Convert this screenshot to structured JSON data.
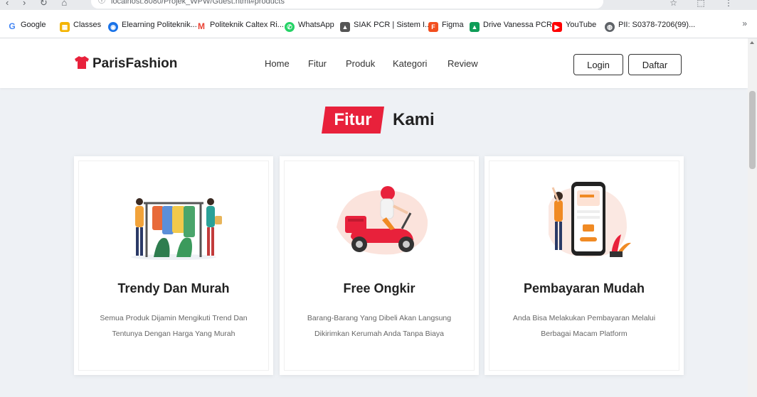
{
  "browser": {
    "address": "localhost:8080/Projek_WPW/Guest.html#products",
    "bookmarks": [
      {
        "label": "Google",
        "icon": "google-icon",
        "color": "#4285f4"
      },
      {
        "label": "Classes",
        "icon": "classes-icon",
        "color": "#f4b400"
      },
      {
        "label": "Elearning Politeknik...",
        "icon": "elearning-icon",
        "color": "#1a73e8"
      },
      {
        "label": "Politeknik Caltex Ri...",
        "icon": "gmail-icon",
        "color": "#ea4335"
      },
      {
        "label": "WhatsApp",
        "icon": "whatsapp-icon",
        "color": "#25d366"
      },
      {
        "label": "SIAK PCR | Sistem I...",
        "icon": "siak-icon",
        "color": "#555555"
      },
      {
        "label": "Figma",
        "icon": "figma-icon",
        "color": "#f24e1e"
      },
      {
        "label": "Drive Vanessa PCR",
        "icon": "drive-icon",
        "color": "#0f9d58"
      },
      {
        "label": "YouTube",
        "icon": "youtube-icon",
        "color": "#ff0000"
      },
      {
        "label": "PII: S0378-7206(99)...",
        "icon": "globe-icon",
        "color": "#5f6368"
      }
    ],
    "more": "»"
  },
  "navbar": {
    "brand": "ParisFashion",
    "brand_color": "#e8213b",
    "menu": [
      "Home",
      "Fitur",
      "Produk",
      "Kategori",
      "Review"
    ],
    "login_label": "Login",
    "register_label": "Daftar"
  },
  "section": {
    "title_highlight": "Fitur",
    "title_rest": "Kami",
    "accent": "#e8213b"
  },
  "features": [
    {
      "title": "Trendy Dan Murah",
      "description": "Semua Produk Dijamin Mengikuti Trend Dan Tentunya Dengan Harga Yang Murah",
      "illustration": "clothing-rack-illustration"
    },
    {
      "title": "Free Ongkir",
      "description": "Barang-Barang Yang Dibeli Akan Langsung Dikirimkan Kerumah Anda Tanpa Biaya",
      "illustration": "delivery-scooter-illustration"
    },
    {
      "title": "Pembayaran Mudah",
      "description": "Anda Bisa Melakukan Pembayaran Melalui Berbagai Macam Platform",
      "illustration": "mobile-payment-illustration"
    }
  ]
}
